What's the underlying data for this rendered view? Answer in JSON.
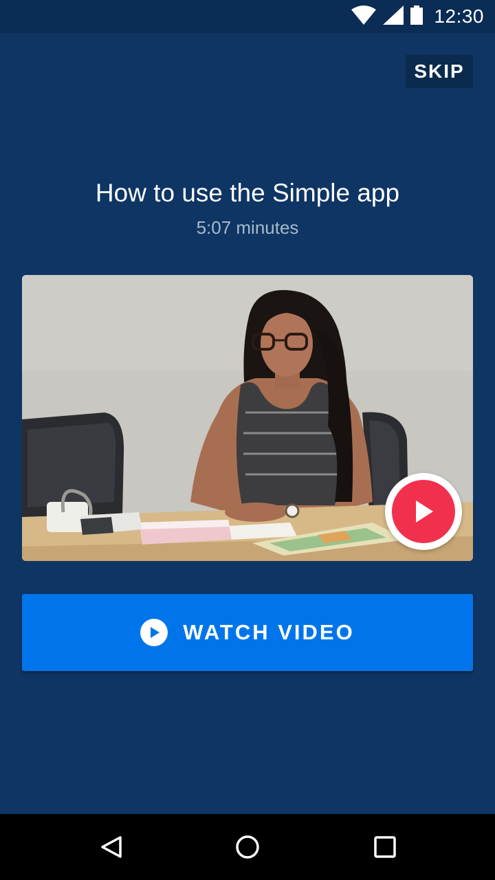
{
  "status_bar": {
    "time": "12:30",
    "icons": [
      "wifi-icon",
      "signal-icon",
      "battery-icon"
    ]
  },
  "header": {
    "skip_label": "SKIP"
  },
  "content": {
    "title": "How to use the Simple app",
    "duration": "5:07 minutes"
  },
  "video": {
    "thumbnail": "person-seated-at-desk-thumbnail",
    "play_icon": "play-icon"
  },
  "watch_button": {
    "label": "WATCH VIDEO",
    "icon": "play-circle-icon"
  },
  "nav_bar": {
    "icons": [
      "back-icon",
      "home-icon",
      "recents-icon"
    ]
  },
  "colors": {
    "background": "#0e3563",
    "status_bar": "#0a2c55",
    "skip_bg": "#0a2a4e",
    "primary_button": "#0075eb",
    "play_accent": "#f1304e",
    "subtitle": "#a9b9cc"
  }
}
